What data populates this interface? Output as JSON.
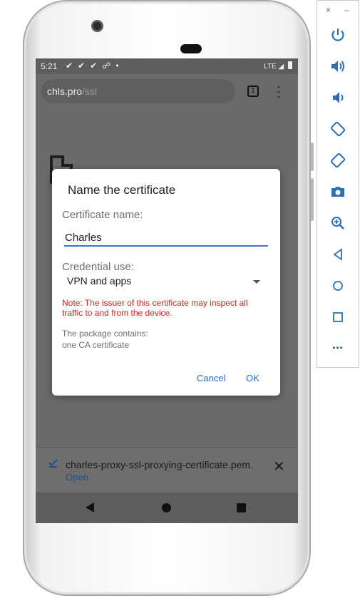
{
  "status_bar": {
    "time": "5:21",
    "network": "LTE"
  },
  "browser": {
    "url_host": "chls.pro",
    "url_path": "/ssl",
    "tab_count": "1"
  },
  "dialog": {
    "title": "Name the certificate",
    "name_label": "Certificate name:",
    "name_value": "Charles",
    "use_label": "Credential use:",
    "use_value": "VPN and apps",
    "note": "Note: The issuer of this certificate may inspect all traffic to and from the device.",
    "package_line1": "The package contains:",
    "package_line2": "one CA certificate",
    "cancel_label": "Cancel",
    "ok_label": "OK"
  },
  "download": {
    "filename": "charles-proxy-ssl-proxying-certificate.pem.",
    "open_label": "Open"
  },
  "emulator_toolbar": {
    "close_label": "×",
    "minimize_label": "–",
    "more_label": "•••",
    "icons": [
      "power-icon",
      "volume-up-icon",
      "volume-down-icon",
      "rotate-left-icon",
      "rotate-right-icon",
      "camera-icon",
      "zoom-icon",
      "back-icon",
      "home-icon",
      "overview-icon",
      "more-icon"
    ]
  },
  "colors": {
    "accent": "#2d7ddf",
    "warning": "#e0201f",
    "scrim": "#6a6a6a"
  }
}
